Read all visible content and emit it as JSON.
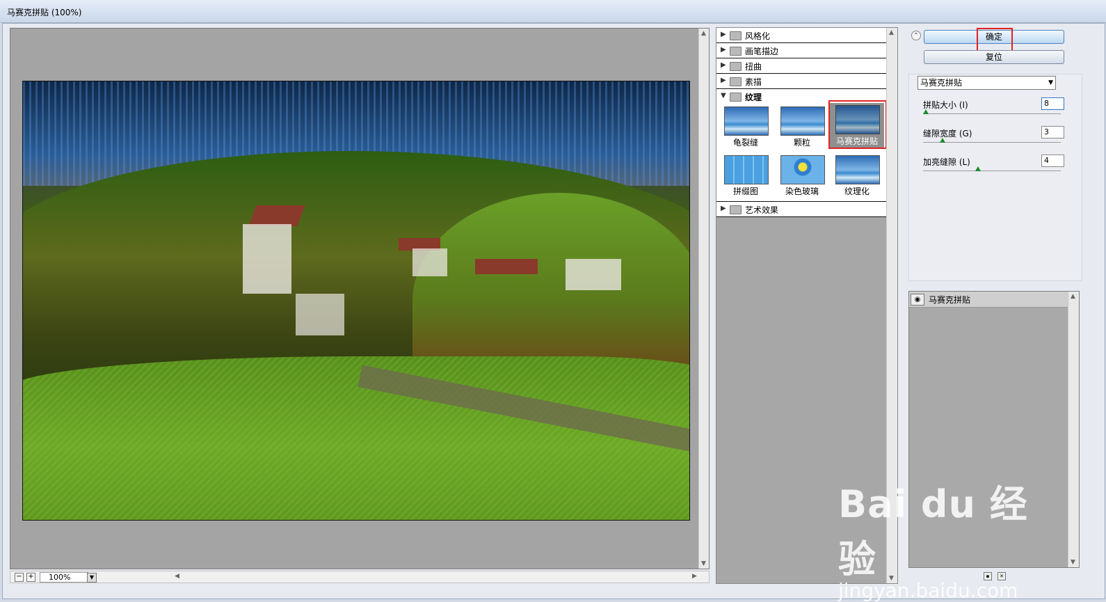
{
  "window": {
    "title": "马赛克拼贴 (100%)"
  },
  "preview": {
    "zoom": "100%",
    "zoom_out": "−",
    "zoom_in": "+"
  },
  "gallery": {
    "categories": [
      {
        "label": "风格化",
        "state": "collapsed"
      },
      {
        "label": "画笔描边",
        "state": "collapsed"
      },
      {
        "label": "扭曲",
        "state": "collapsed"
      },
      {
        "label": "素描",
        "state": "collapsed"
      },
      {
        "label": "纹理",
        "state": "expanded"
      },
      {
        "label": "艺术效果",
        "state": "collapsed"
      }
    ],
    "texture_filters": [
      {
        "label": "龟裂缝"
      },
      {
        "label": "颗粒"
      },
      {
        "label": "马赛克拼贴",
        "selected": true
      },
      {
        "label": "拼缀图"
      },
      {
        "label": "染色玻璃"
      },
      {
        "label": "纹理化"
      }
    ]
  },
  "actions": {
    "ok": "确定",
    "reset": "复位"
  },
  "filter_select": {
    "value": "马赛克拼贴"
  },
  "params": [
    {
      "label": "拼贴大小 (I)",
      "value": "8",
      "fraction": 0.02
    },
    {
      "label": "缝隙宽度 (G)",
      "value": "3",
      "fraction": 0.14
    },
    {
      "label": "加亮缝隙 (L)",
      "value": "4",
      "fraction": 0.4
    }
  ],
  "layers": [
    {
      "label": "马赛克拼贴"
    }
  ],
  "colors": {
    "highlight": "#e02222",
    "knob": "#1a8a2a"
  },
  "watermark": {
    "brand": "Bai du 经验",
    "url": "jingyan.baidu.com"
  }
}
